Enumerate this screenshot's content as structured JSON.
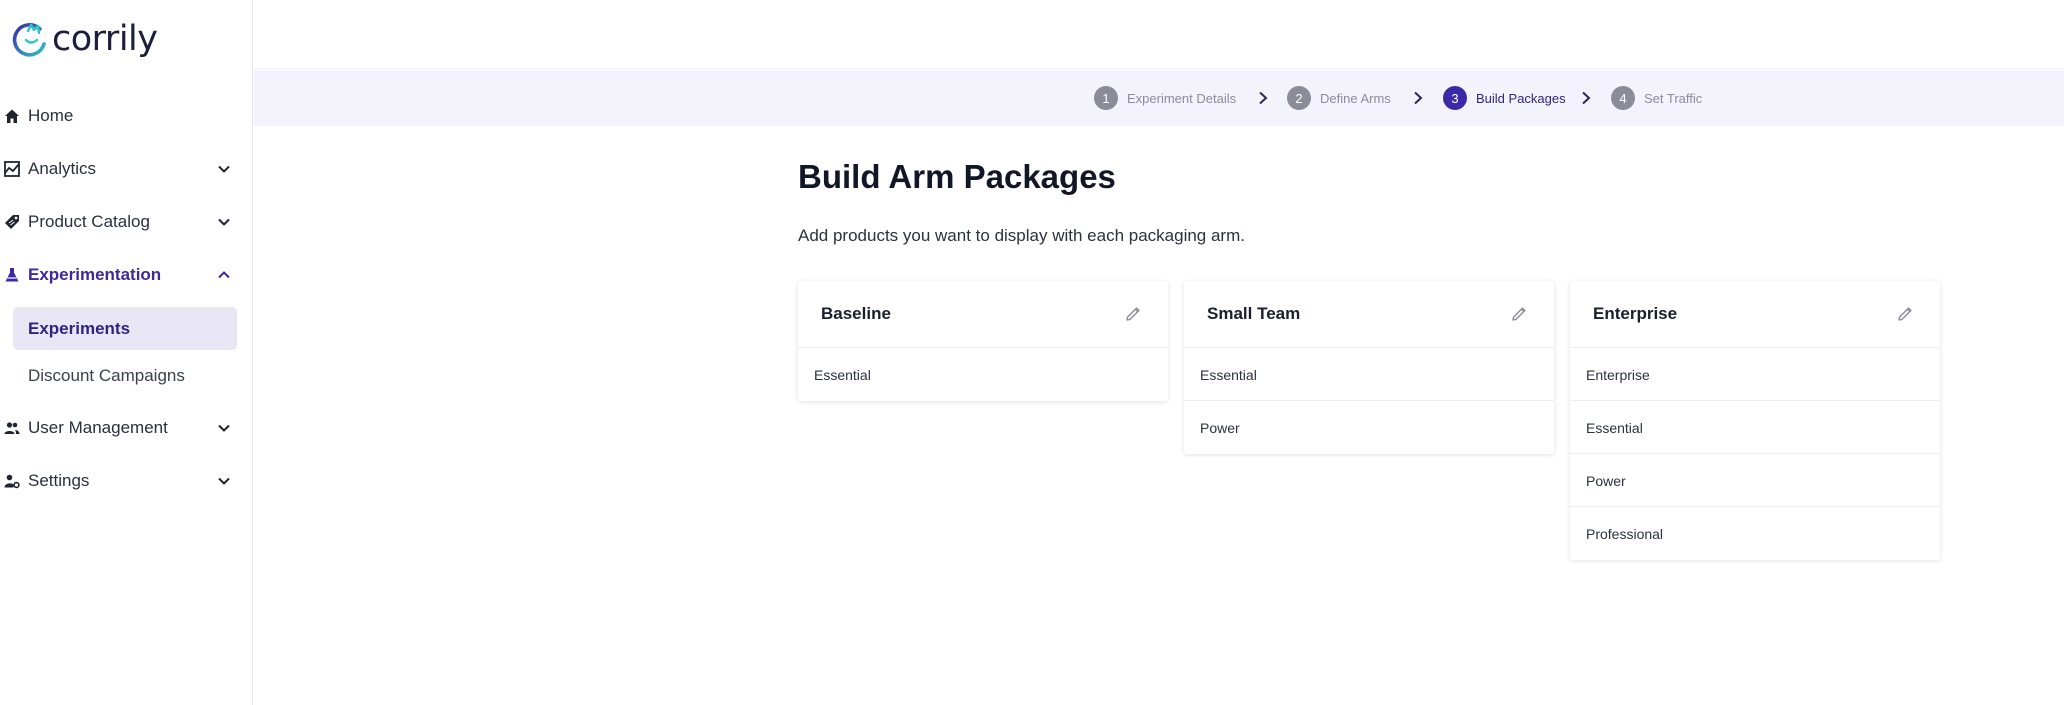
{
  "app": {
    "logo_text": "corrily"
  },
  "sidebar": {
    "items": [
      {
        "label": "Home",
        "icon": "home-icon"
      },
      {
        "label": "Analytics",
        "icon": "analytics-icon"
      },
      {
        "label": "Product Catalog",
        "icon": "tag-icon"
      },
      {
        "label": "Experimentation",
        "icon": "flask-icon",
        "expanded": true
      },
      {
        "label": "User Management",
        "icon": "users-icon"
      },
      {
        "label": "Settings",
        "icon": "user-settings-icon"
      }
    ],
    "sub_items": [
      {
        "label": "Experiments",
        "selected": true
      },
      {
        "label": "Discount Campaigns",
        "selected": false
      }
    ]
  },
  "stepper": {
    "steps": [
      {
        "number": "1",
        "label": "Experiment Details"
      },
      {
        "number": "2",
        "label": "Define Arms"
      },
      {
        "number": "3",
        "label": "Build Packages",
        "current": true
      },
      {
        "number": "4",
        "label": "Set Traffic"
      }
    ]
  },
  "main": {
    "title": "Build Arm Packages",
    "subtitle": "Add products you want to display with each packaging arm.",
    "arms": [
      {
        "name": "Baseline",
        "products": [
          "Essential"
        ]
      },
      {
        "name": "Small Team",
        "products": [
          "Essential",
          "Power"
        ]
      },
      {
        "name": "Enterprise",
        "products": [
          "Enterprise",
          "Essential",
          "Power",
          "Professional"
        ]
      }
    ]
  },
  "colors": {
    "accent": "#3b2aa8",
    "accent_text": "#2f2580",
    "selected_bg": "#e9e7f6",
    "stepper_bg": "#f4f3fc",
    "inactive_step": "#8b8c98"
  }
}
